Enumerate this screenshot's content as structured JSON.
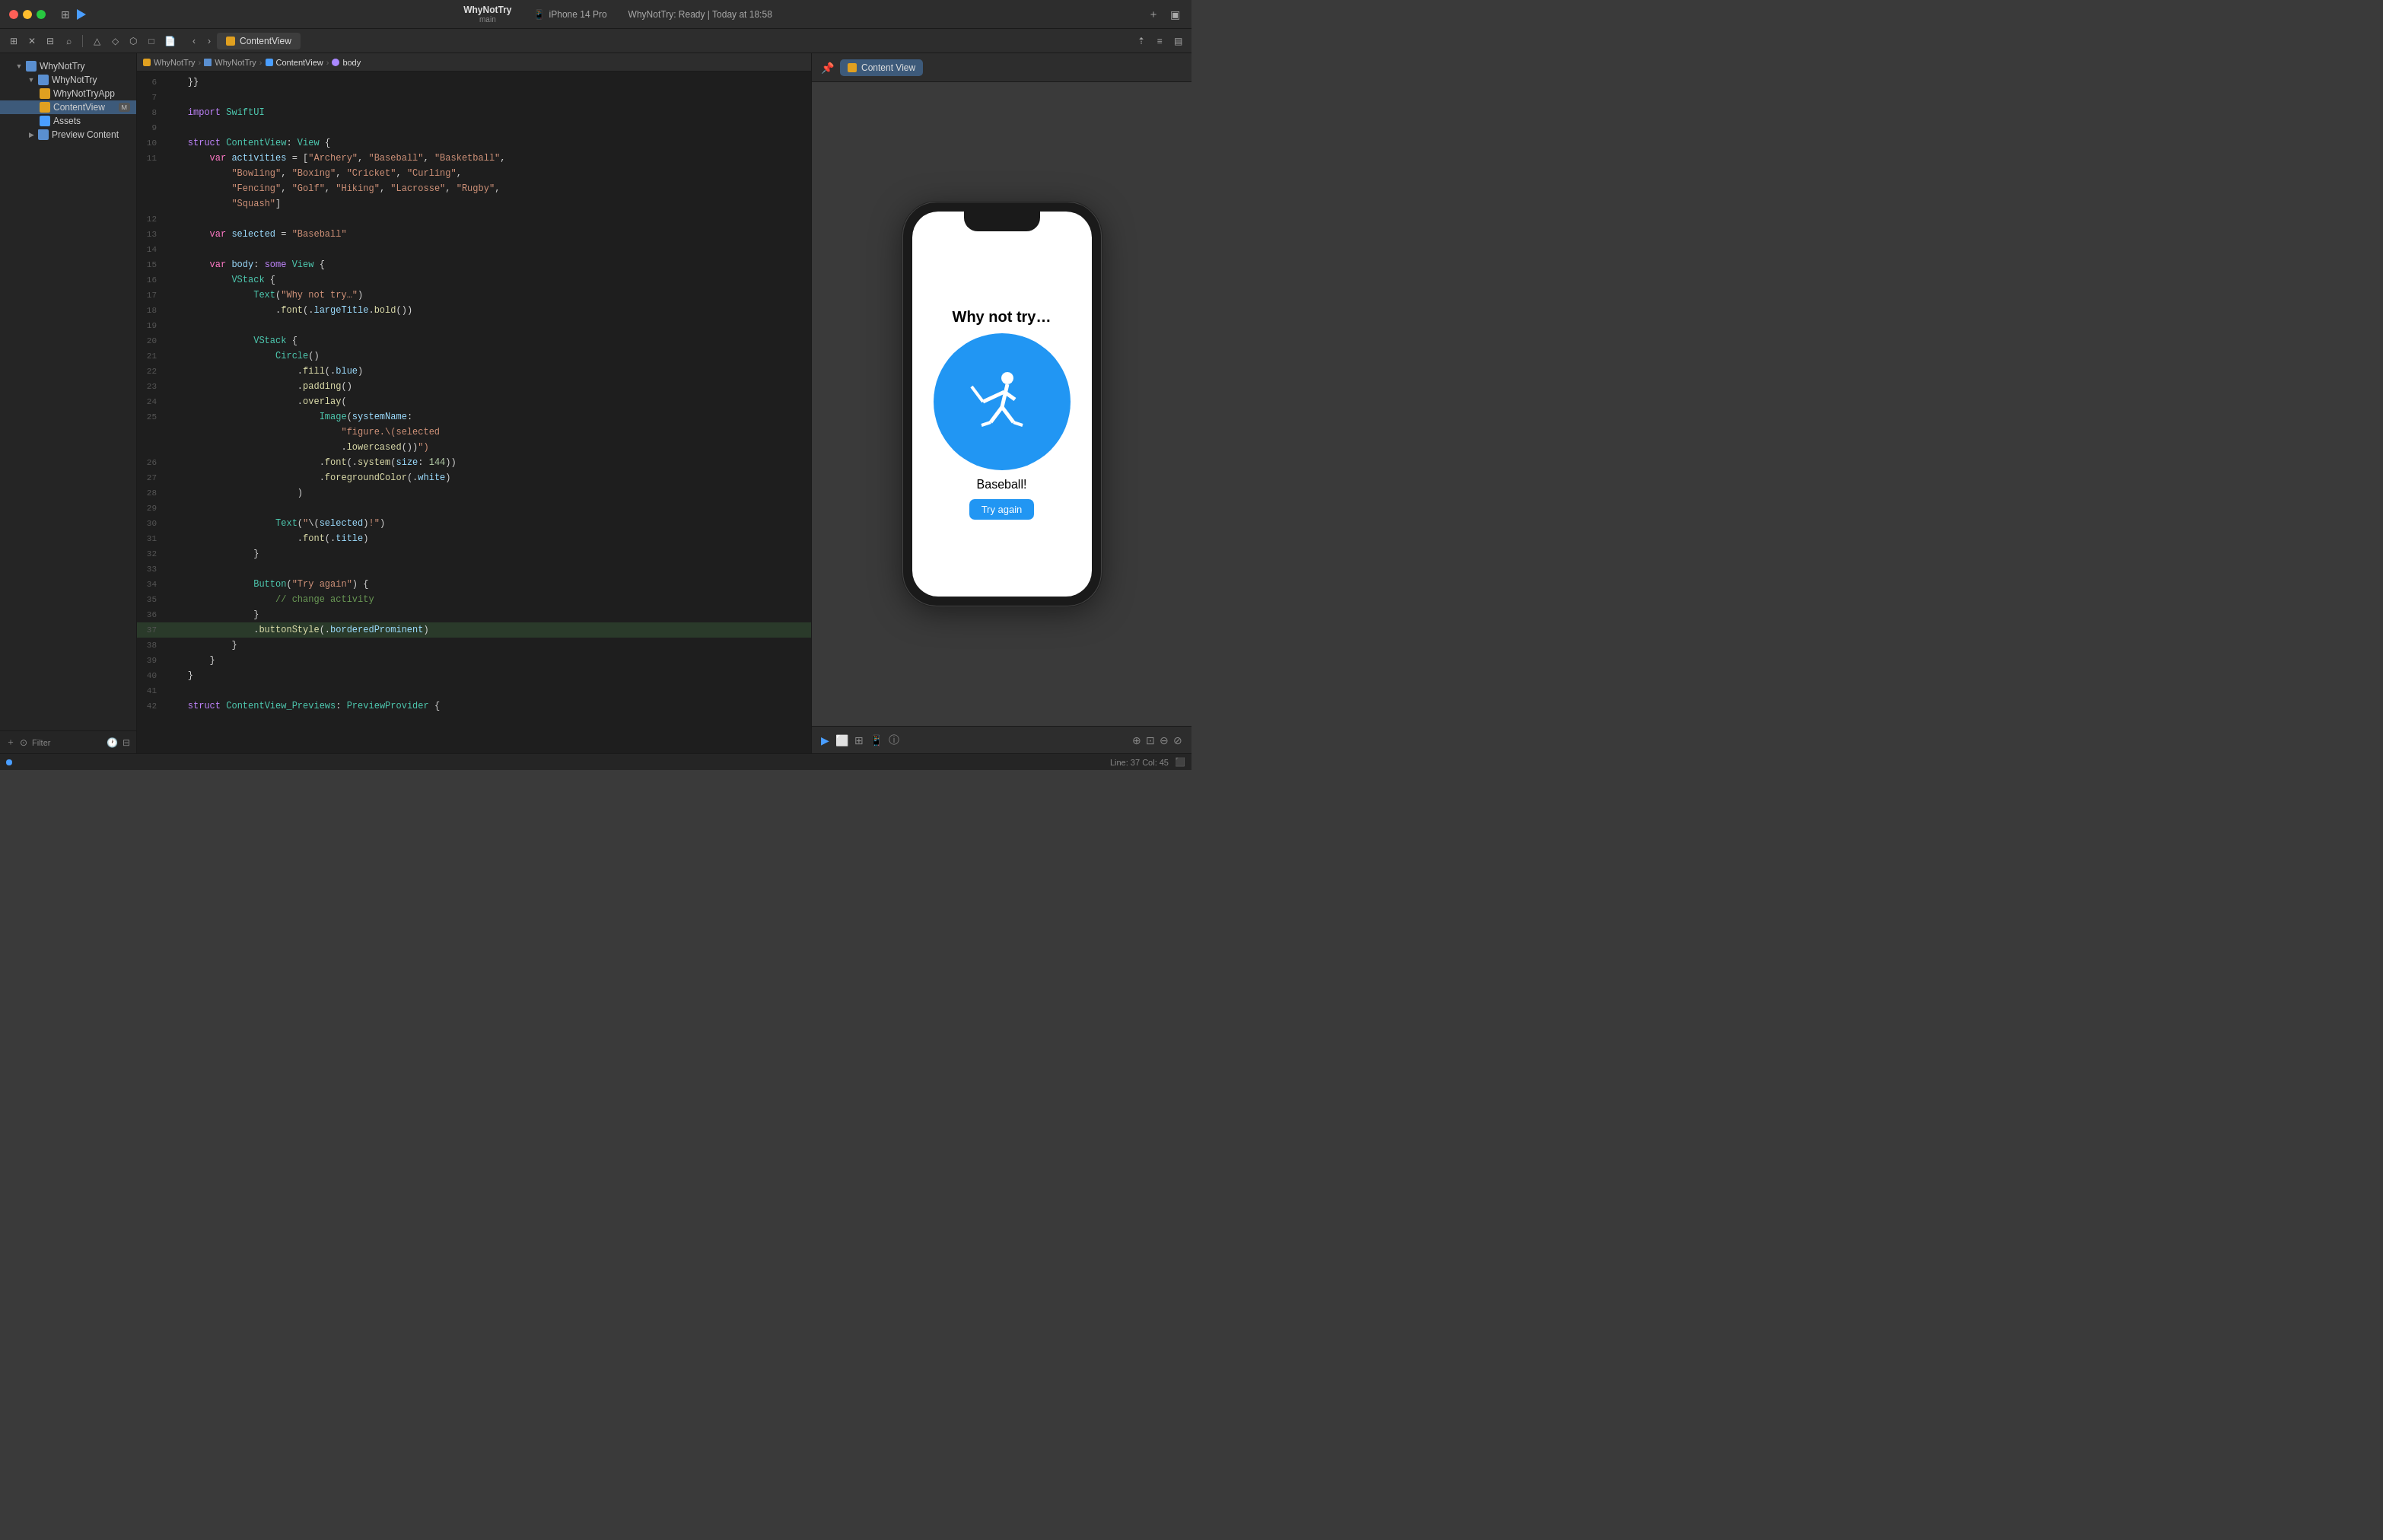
{
  "titlebar": {
    "project_name": "WhyNotTry",
    "branch": "main",
    "device": "iPhone 14 Pro",
    "device_icon": "📱",
    "status": "WhyNotTry: Ready | Today at 18:58",
    "run_label": "Run",
    "plus_label": "+",
    "layout_label": "⬛"
  },
  "toolbar": {
    "tab_name": "ContentView",
    "nav_back": "‹",
    "nav_forward": "›"
  },
  "breadcrumb": {
    "items": [
      "WhyNotTry",
      "WhyNotTry",
      "ContentView",
      "body"
    ],
    "separators": [
      "›",
      "›",
      "›"
    ]
  },
  "sidebar": {
    "project_root": "WhyNotTry",
    "items": [
      {
        "label": "WhyNotTry",
        "indent": 1,
        "type": "group",
        "expanded": true
      },
      {
        "label": "WhyNotTryApp",
        "indent": 2,
        "type": "swift"
      },
      {
        "label": "ContentView",
        "indent": 2,
        "type": "swift",
        "badge": "M",
        "selected": true
      },
      {
        "label": "Assets",
        "indent": 2,
        "type": "assets"
      },
      {
        "label": "Preview Content",
        "indent": 2,
        "type": "folder"
      }
    ],
    "filter_placeholder": "Filter"
  },
  "code": {
    "lines": [
      {
        "num": 6,
        "text": "    }}"
      },
      {
        "num": 7,
        "text": ""
      },
      {
        "num": 8,
        "text": "    import SwiftUI"
      },
      {
        "num": 9,
        "text": ""
      },
      {
        "num": 10,
        "text": "    struct ContentView: View {"
      },
      {
        "num": 11,
        "text": "        var activities = [\"Archery\", \"Baseball\", \"Basketball\","
      },
      {
        "num": 11,
        "text": "            \"Bowling\", \"Boxing\", \"Cricket\", \"Curling\","
      },
      {
        "num": 11,
        "text": "            \"Fencing\", \"Golf\", \"Hiking\", \"Lacrosse\", \"Rugby\","
      },
      {
        "num": 11,
        "text": "            \"Squash\"]"
      },
      {
        "num": 12,
        "text": ""
      },
      {
        "num": 13,
        "text": "        var selected = \"Baseball\""
      },
      {
        "num": 14,
        "text": ""
      },
      {
        "num": 15,
        "text": "        var body: some View {"
      },
      {
        "num": 16,
        "text": "            VStack {"
      },
      {
        "num": 17,
        "text": "                Text(\"Why not try…\")"
      },
      {
        "num": 18,
        "text": "                    .font(.largeTitle.bold())"
      },
      {
        "num": 19,
        "text": ""
      },
      {
        "num": 20,
        "text": "                VStack {"
      },
      {
        "num": 21,
        "text": "                    Circle()"
      },
      {
        "num": 22,
        "text": "                        .fill(.blue)"
      },
      {
        "num": 23,
        "text": "                        .padding()"
      },
      {
        "num": 24,
        "text": "                        .overlay("
      },
      {
        "num": 25,
        "text": "                            Image(systemName:"
      },
      {
        "num": 25,
        "text": "                                \"figure.\\(selected"
      },
      {
        "num": 25,
        "text": "                                .lowercased())\")"
      },
      {
        "num": 26,
        "text": "                            .font(.system(size: 144))"
      },
      {
        "num": 27,
        "text": "                            .foregroundColor(.white)"
      },
      {
        "num": 28,
        "text": "                        )"
      },
      {
        "num": 29,
        "text": ""
      },
      {
        "num": 30,
        "text": "                    Text(\"\\(selected)!\")"
      },
      {
        "num": 31,
        "text": "                        .font(.title)"
      },
      {
        "num": 32,
        "text": "                }"
      },
      {
        "num": 33,
        "text": ""
      },
      {
        "num": 34,
        "text": "                Button(\"Try again\") {"
      },
      {
        "num": 35,
        "text": "                    // change activity"
      },
      {
        "num": 36,
        "text": "                }"
      },
      {
        "num": 37,
        "text": "                .buttonStyle(.borderedProminent)",
        "highlighted": true
      },
      {
        "num": 38,
        "text": "            }"
      },
      {
        "num": 39,
        "text": "        }"
      },
      {
        "num": 40,
        "text": "    }"
      },
      {
        "num": 41,
        "text": ""
      },
      {
        "num": 42,
        "text": "    struct ContentView_Previews: PreviewProvider {"
      }
    ]
  },
  "preview": {
    "tab_label": "Content View",
    "pin_icon": "📌",
    "app": {
      "title": "Why not try…",
      "activity": "Baseball!",
      "try_again_label": "Try again",
      "icon_color": "#2196F3"
    }
  },
  "statusbar": {
    "line_col": "Line: 37  Col: 45"
  }
}
